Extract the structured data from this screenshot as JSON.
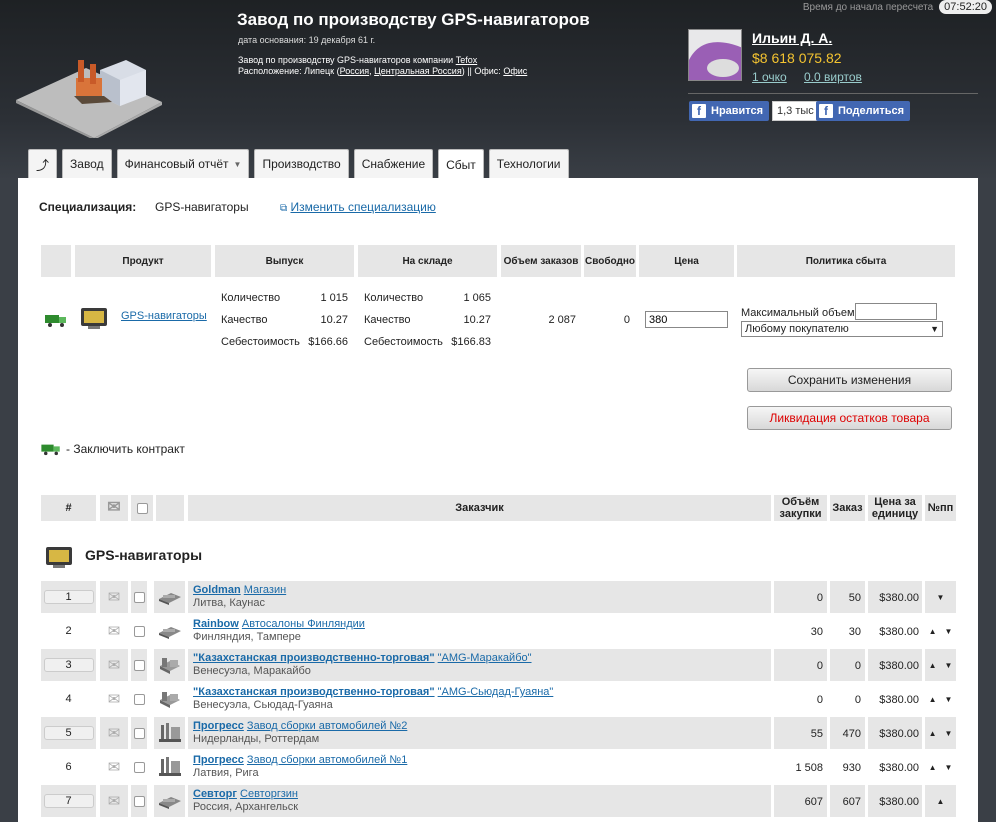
{
  "header": {
    "title": "Завод по производству GPS-навигаторов",
    "founded": "дата основания: 19 декабря 61 г.",
    "desc_prefix": "Завод по производству GPS-навигаторов компании",
    "company_link": "Tefox",
    "location_prefix": "Расположение: Липецк (",
    "country_link": "Россия",
    "region_link": "Центральная Россия",
    "office_prefix": ") || Офис:",
    "office_link": "Офис",
    "timer_label": "Время до начала пересчета",
    "timer_value": "07:52:20"
  },
  "user": {
    "name": "Ильин Д. А.",
    "money": "$8 618 075.82",
    "points": "1 очко",
    "virts": "0.0 виртов"
  },
  "social": {
    "like": "Нравится",
    "count": "1,3 тыс",
    "share": "Поделиться"
  },
  "tabs": [
    {
      "label": "",
      "icon": "arrow-icon"
    },
    {
      "label": "Завод"
    },
    {
      "label": "Финансовый отчёт"
    },
    {
      "label": "Производство"
    },
    {
      "label": "Снабжение"
    },
    {
      "label": "Сбыт"
    },
    {
      "label": "Технологии"
    }
  ],
  "spec": {
    "label": "Специализация:",
    "value": "GPS-навигаторы",
    "change": "Изменить специализацию"
  },
  "sales_headers": [
    "Продукт",
    "Выпуск",
    "На складе",
    "Объем заказов",
    "Свободно",
    "Цена",
    "Политика сбыта"
  ],
  "product": {
    "name": "GPS-навигаторы",
    "output": {
      "qty_label": "Количество",
      "qty": "1 015",
      "qual_label": "Качество",
      "qual": "10.27",
      "cost_label": "Себестоимость",
      "cost": "$166.66"
    },
    "stock": {
      "qty_label": "Количество",
      "qty": "1 065",
      "qual_label": "Качество",
      "qual": "10.27",
      "cost_label": "Себестоимость",
      "cost": "$166.83"
    },
    "orders": "2 087",
    "free": "0",
    "price": "380",
    "max_volume_label": "Максимальный объем:",
    "policy": "Любому покупателю"
  },
  "buttons": {
    "save": "Сохранить изменения",
    "liquidate": "Ликвидация остатков товара"
  },
  "contract_note": "- Заключить контракт",
  "orders_headers": {
    "num": "#",
    "customer": "Заказчик",
    "volume": "Объём закупки",
    "order": "Заказ",
    "price": "Цена за единицу",
    "pp": "№пп"
  },
  "group_title": "GPS-навигаторы",
  "rows": [
    {
      "n": "1",
      "name": "Goldman",
      "unit": "Магазин",
      "loc": "Литва, Каунас",
      "vol": "0",
      "ord": "50",
      "price": "$380.00",
      "arrows": "down",
      "icon": "shop"
    },
    {
      "n": "2",
      "name": "Rainbow",
      "unit": "Автосалоны Финляндии",
      "loc": "Финляндия, Тампере",
      "vol": "30",
      "ord": "30",
      "price": "$380.00",
      "arrows": "both",
      "icon": "shop"
    },
    {
      "n": "3",
      "name": "\"Казахстанская производственно-торговая\"",
      "unit": "\"AMG-Маракайбо\"",
      "loc": "Венесуэла, Маракайбо",
      "vol": "0",
      "ord": "0",
      "price": "$380.00",
      "arrows": "both",
      "icon": "factory"
    },
    {
      "n": "4",
      "name": "\"Казахстанская производственно-торговая\"",
      "unit": "\"AMG-Сьюдад-Гуаяна\"",
      "loc": "Венесуэла, Сьюдад-Гуаяна",
      "vol": "0",
      "ord": "0",
      "price": "$380.00",
      "arrows": "both",
      "icon": "factory"
    },
    {
      "n": "5",
      "name": "Прогресс",
      "unit": "Завод сборки автомобилей №2",
      "loc": "Нидерланды, Роттердам",
      "vol": "55",
      "ord": "470",
      "price": "$380.00",
      "arrows": "both",
      "icon": "plant"
    },
    {
      "n": "6",
      "name": "Прогресс",
      "unit": "Завод сборки автомобилей №1",
      "loc": "Латвия, Рига",
      "vol": "1 508",
      "ord": "930",
      "price": "$380.00",
      "arrows": "both",
      "icon": "plant"
    },
    {
      "n": "7",
      "name": "Севторг",
      "unit": "Севторгзин",
      "loc": "Россия, Архангельск",
      "vol": "607",
      "ord": "607",
      "price": "$380.00",
      "arrows": "up",
      "icon": "shop"
    }
  ]
}
